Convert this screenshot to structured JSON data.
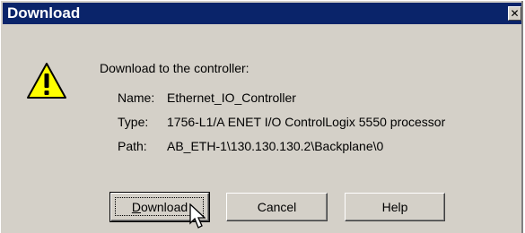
{
  "window": {
    "title": "Download",
    "close_glyph": "✕"
  },
  "dialog": {
    "icon": "warning-icon",
    "heading": "Download to the controller:",
    "fields": [
      {
        "label": "Name:",
        "value": "Ethernet_IO_Controller"
      },
      {
        "label": "Type:",
        "value": "1756-L1/A ENET I/O ControlLogix 5550 processor"
      },
      {
        "label": "Path:",
        "value": "AB_ETH-1\\130.130.130.2\\Backplane\\0"
      }
    ]
  },
  "buttons": {
    "download_label": "Download",
    "cancel_label": "Cancel",
    "help_label": "Help"
  },
  "colors": {
    "titlebar": "#0a246a",
    "face": "#d4d0c8",
    "warning": "#ffff00"
  }
}
